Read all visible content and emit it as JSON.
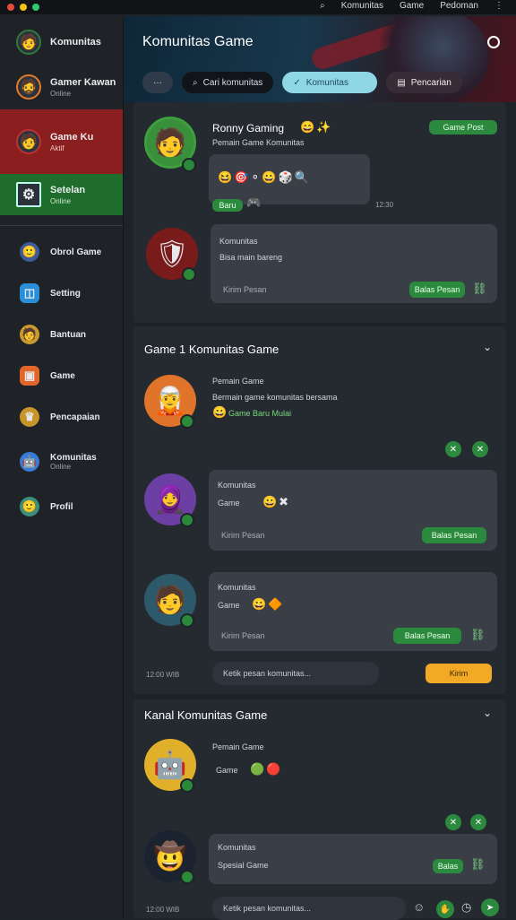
{
  "top": {
    "nav": [
      "Komunitas",
      "Game",
      "Pedoman"
    ]
  },
  "sidebar": {
    "items": [
      {
        "label": "Komunitas",
        "sub": "",
        "icon": "avatar-man"
      },
      {
        "label": "Gamer Kawan",
        "sub": "Online",
        "icon": "avatar-orange"
      },
      {
        "label": "Game Ku",
        "sub": "Aktif",
        "icon": "avatar-red"
      },
      {
        "label": "Setelan",
        "sub": "Online",
        "icon": "settings-icon"
      }
    ],
    "small": [
      {
        "label": "Obrol Game",
        "icon": "blue-avatar"
      },
      {
        "label": "Setting",
        "icon": "blue-square"
      },
      {
        "label": "Bantuan",
        "icon": "yellow-avatar"
      },
      {
        "label": "Game",
        "icon": "orange-square"
      },
      {
        "label": "Pencapaian",
        "icon": "gold-icon"
      },
      {
        "label": "Komunitas",
        "sub": "Online",
        "icon": "gear-avatar"
      },
      {
        "label": "Profil",
        "icon": "green-avatar"
      }
    ]
  },
  "hero": {
    "title": "Komunitas Game",
    "pills": [
      "···",
      "Cari komunitas",
      "Komunitas",
      "Pencarian"
    ]
  },
  "post1": {
    "name": "Ronny Gaming",
    "sub": "Pemain Game Komunitas",
    "tag": "Game Post",
    "time": "12:30",
    "mini": "Baru"
  },
  "post2": {
    "title": "Komunitas",
    "line": "Bisa main bareng",
    "foot": "Kirim Pesan",
    "btn": "Balas Pesan"
  },
  "section1": {
    "title": "Game 1 Komunitas Game"
  },
  "post3": {
    "name": "Pemain Game",
    "line": "Bermain game komunitas bersama",
    "line2": "Game Baru Mulai"
  },
  "post4": {
    "title": "Komunitas",
    "line": "Game",
    "foot": "Kirim Pesan",
    "btn": "Balas Pesan"
  },
  "post5": {
    "title": "Komunitas",
    "line": "Game",
    "foot": "Kirim Pesan",
    "btn": "Balas Pesan"
  },
  "input1": {
    "placeholder": "Ketik pesan komunitas...",
    "send": "Kirim",
    "time": "12:00 WIB"
  },
  "section2": {
    "title": "Kanal Komunitas Game"
  },
  "post6": {
    "name": "Pemain Game",
    "line": "Game"
  },
  "post7": {
    "title": "Komunitas",
    "line": "Spesial Game",
    "btn": "Balas",
    "time": "12:00"
  },
  "input2": {
    "placeholder": "Ketik pesan komunitas...",
    "time": "12:00 WIB"
  }
}
